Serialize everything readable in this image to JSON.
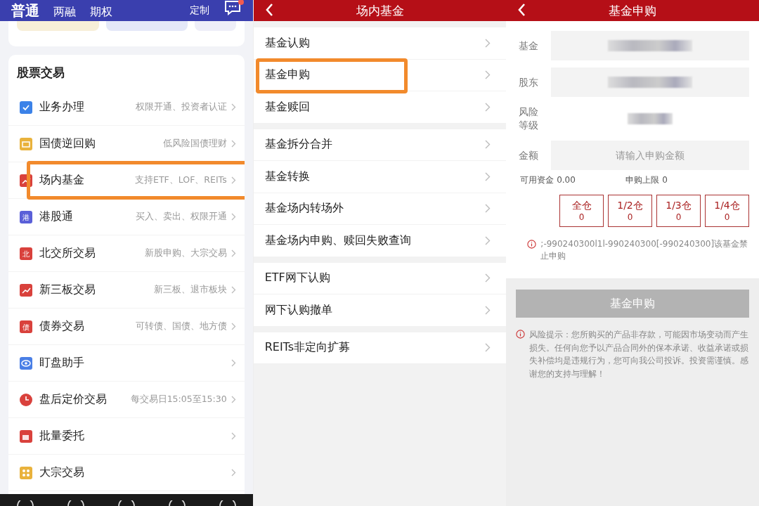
{
  "home": {
    "tabs": [
      {
        "label": "普通",
        "selected": true
      },
      {
        "label": "两融",
        "selected": false
      },
      {
        "label": "期权",
        "selected": false
      }
    ],
    "customize": "定制",
    "section_title": "股票交易",
    "items": [
      {
        "title": "业务办理",
        "subtitle": "权限开通、投资者认证",
        "color": "#3b82e8",
        "highlighted": false
      },
      {
        "title": "国债逆回购",
        "subtitle": "低风险国债理财",
        "color": "#e9b23c",
        "highlighted": false
      },
      {
        "title": "场内基金",
        "subtitle": "支持ETF、LOF、REITs",
        "color": "#d9413c",
        "highlighted": true
      },
      {
        "title": "港股通",
        "subtitle": "买入、卖出、权限开通",
        "color": "#5a5fd8",
        "glyph": "港",
        "highlighted": false
      },
      {
        "title": "北交所交易",
        "subtitle": "新股申购、大宗交易",
        "color": "#d9413c",
        "glyph": "北",
        "highlighted": false
      },
      {
        "title": "新三板交易",
        "subtitle": "新三板、退市板块",
        "color": "#d9413c",
        "highlighted": false
      },
      {
        "title": "债券交易",
        "subtitle": "可转债、国债、地方债",
        "color": "#d9413c",
        "glyph": "债",
        "highlighted": false
      },
      {
        "title": "盯盘助手",
        "color": "#4a7fe6",
        "highlighted": false
      },
      {
        "title": "盘后定价交易",
        "subtitle": "每交易日15:05至15:30",
        "color": "#d9413c",
        "highlighted": false
      },
      {
        "title": "批量委托",
        "color": "#d9413c",
        "highlighted": false
      },
      {
        "title": "大宗交易",
        "color": "#e9b23c",
        "highlighted": false
      }
    ]
  },
  "funds": {
    "title": "场内基金",
    "groups": [
      [
        {
          "label": "基金认购",
          "highlighted": false
        },
        {
          "label": "基金申购",
          "highlighted": true
        },
        {
          "label": "基金赎回",
          "highlighted": false
        }
      ],
      [
        {
          "label": "基金拆分合并",
          "highlighted": false
        },
        {
          "label": "基金转换",
          "highlighted": false
        },
        {
          "label": "基金场内转场外",
          "highlighted": false
        },
        {
          "label": "基金场内申购、赎回失败查询",
          "highlighted": false
        }
      ],
      [
        {
          "label": "ETF网下认购",
          "highlighted": false
        },
        {
          "label": "网下认购撤单",
          "highlighted": false
        }
      ],
      [
        {
          "label": "REITs非定向扩募",
          "highlighted": false
        }
      ]
    ]
  },
  "purchase": {
    "title": "基金申购",
    "fields": [
      {
        "label": "基金",
        "kind": "blurred"
      },
      {
        "label": "股东",
        "kind": "blurred"
      },
      {
        "label": "风险等级",
        "kind": "plain-blurred"
      },
      {
        "label": "金额",
        "kind": "input",
        "placeholder": "请输入申购金额"
      }
    ],
    "available_label": "可用资金",
    "available": "0.00",
    "limit_label": "申购上限",
    "limit": "0",
    "positions": [
      {
        "label": "全仓",
        "value": "0"
      },
      {
        "label": "1/2仓",
        "value": "0"
      },
      {
        "label": "1/3仓",
        "value": "0"
      },
      {
        "label": "1/4仓",
        "value": "0"
      }
    ],
    "error": ";-990240300l1l-990240300[-990240300]该基金禁止申购",
    "submit": {
      "label": "基金申购",
      "disabled": true
    },
    "risk_notice": "风险提示：您所购买的产品非存款，可能因市场变动而产生损失。任何向您予以产品合同外的保本承诺、收益承诺或损失补偿均是违规行为，您可向我公司投诉。投资需谨慎。感谢您的支持与理解！"
  }
}
